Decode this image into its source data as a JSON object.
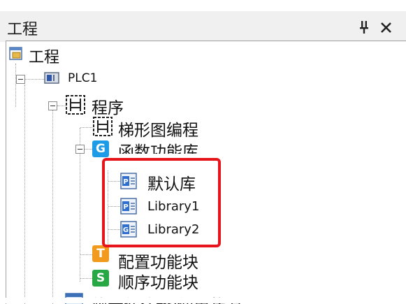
{
  "panel": {
    "title": "工程",
    "pin_glyph": "ᵖ",
    "close_glyph": "×"
  },
  "tree": {
    "root": {
      "label": "工程",
      "icon": "project-folder-icon"
    },
    "plc": {
      "label": "PLC1",
      "icon": "plc-device-icon"
    },
    "program": {
      "label": "程序",
      "icon": "program-icon"
    },
    "ladder": {
      "label": "梯形图编程",
      "icon": "ladder-icon"
    },
    "function_lib": {
      "label": "函数功能库",
      "icon_text": "G",
      "icon": "function-library-icon"
    },
    "default_lib": {
      "label": "默认库",
      "icon_text": "P",
      "icon": "p-library-icon"
    },
    "library1": {
      "label": "Library1",
      "icon_text": "P",
      "icon": "p-library-icon"
    },
    "library2": {
      "label": "Library2",
      "icon_text": "G",
      "icon": "g-library-icon"
    },
    "config_block": {
      "label": "配置功能块",
      "icon_text": "T",
      "icon": "config-block-icon"
    },
    "sequence_block": {
      "label": "顺序功能块",
      "icon_text": "S",
      "icon": "sequence-block-icon"
    },
    "soft_component": {
      "label": "软元件注释/使用状况",
      "icon": "soft-component-icon"
    }
  },
  "colors": {
    "highlight": "#e8141c",
    "function_lib_blue": "#1e9be6",
    "config_orange": "#f29a1d",
    "sequence_green": "#27a844"
  }
}
